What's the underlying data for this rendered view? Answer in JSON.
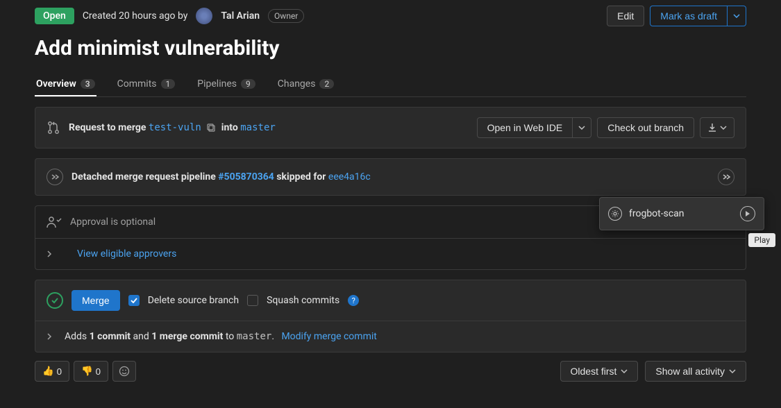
{
  "header": {
    "status": "Open",
    "created_prefix": "Created",
    "created_time": "20 hours ago",
    "by": "by",
    "author": "Tal Arian",
    "owner_label": "Owner",
    "edit": "Edit",
    "mark_draft": "Mark as draft"
  },
  "title": "Add minimist vulnerability",
  "tabs": [
    {
      "label": "Overview",
      "count": "3"
    },
    {
      "label": "Commits",
      "count": "1"
    },
    {
      "label": "Pipelines",
      "count": "9"
    },
    {
      "label": "Changes",
      "count": "2"
    }
  ],
  "merge_request": {
    "prefix": "Request to merge",
    "source": "test-vuln",
    "into": "into",
    "target": "master",
    "open_ide": "Open in Web IDE",
    "checkout": "Check out branch"
  },
  "pipeline": {
    "prefix": "Detached merge request pipeline ",
    "id": "#505870364",
    "skipped": " skipped for ",
    "sha": "eee4a16c"
  },
  "approval": {
    "optional": "Approval is optional",
    "view": "View eligible approvers"
  },
  "merge": {
    "button": "Merge",
    "delete_source": "Delete source branch",
    "squash": "Squash commits",
    "adds": "Adds ",
    "one_commit": "1 commit",
    "and": " and ",
    "one_merge_commit": "1 merge commit",
    "to": " to ",
    "target": "master",
    "period": ".",
    "modify": "Modify merge commit"
  },
  "reactions": {
    "thumbs_up": "👍",
    "thumbs_up_count": "0",
    "thumbs_down": "👎",
    "thumbs_down_count": "0"
  },
  "sort": {
    "oldest": "Oldest first",
    "activity": "Show all activity"
  },
  "popup": {
    "item": "frogbot-scan",
    "tooltip": "Play"
  }
}
